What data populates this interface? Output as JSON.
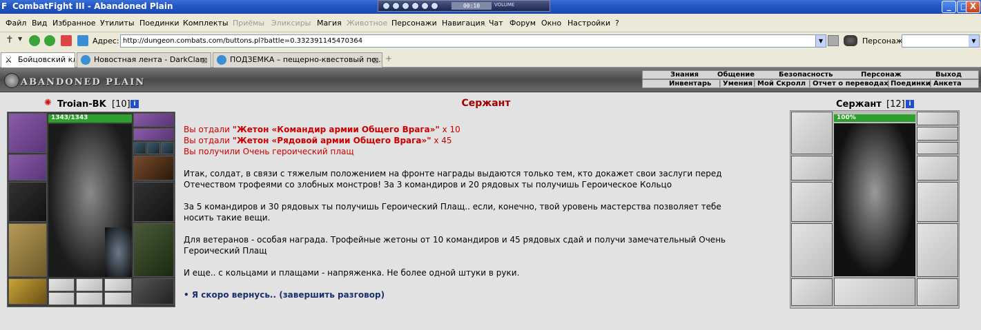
{
  "window": {
    "title": "CombatFight III - Abandoned Plain",
    "app_icon": "F",
    "minimize": "_",
    "maximize": "□",
    "close": "X"
  },
  "player": {
    "time": "00:10",
    "volume_label": "VOLUME"
  },
  "menu": [
    {
      "label": "Файл",
      "enabled": true
    },
    {
      "label": "Вид",
      "enabled": true
    },
    {
      "label": "Избранное",
      "enabled": true
    },
    {
      "label": "Утилиты",
      "enabled": true
    },
    {
      "label": "Поединки",
      "enabled": true
    },
    {
      "label": "Комплекты",
      "enabled": true
    },
    {
      "label": "Приёмы",
      "enabled": false
    },
    {
      "label": "Эликсиры",
      "enabled": false
    },
    {
      "label": "Магия",
      "enabled": true
    },
    {
      "label": "Животное",
      "enabled": false
    },
    {
      "label": "Персонажи",
      "enabled": true
    },
    {
      "label": "Навигация",
      "enabled": true
    },
    {
      "label": "Чат",
      "enabled": true
    },
    {
      "label": "Форум",
      "enabled": true
    },
    {
      "label": "Окно",
      "enabled": true
    },
    {
      "label": "Настройки",
      "enabled": true
    },
    {
      "label": "?",
      "enabled": true
    }
  ],
  "address": {
    "label": "Адрес:",
    "url": "http://dungeon.combats.com/buttons.pl?battle=0.332391145470364",
    "character_label": "Персонаж:"
  },
  "tabs": [
    {
      "label": "Бойцовский клуб",
      "active": true
    },
    {
      "label": "Новостная лента - DarkClan",
      "active": false
    },
    {
      "label": "ПОДЗЕМКА – пещерно-квестовый по...",
      "active": false
    }
  ],
  "game": {
    "logo": "ABANDONED PLAIN",
    "top_menu": [
      "Знания",
      "Общение",
      "Безопасность",
      "Персонаж",
      "Выход"
    ],
    "sub_menu": [
      "Инвентарь",
      "Умения",
      "Мой Скролл",
      "Отчет о переводах",
      "Поединки",
      "Анкета"
    ]
  },
  "player_char": {
    "name": "Troian-BK",
    "level": "[10]",
    "hp": "1343/1343",
    "hp_fraction": 1.0
  },
  "npc": {
    "name": "Сержант",
    "level": "[12]",
    "hp": "100%",
    "hp_fraction": 1.0
  },
  "dialog": {
    "title": "Сержант",
    "given1_prefix": "Вы отдали ",
    "given1_item": "\"Жетон «Командир армии Общего Врага»\"",
    "given1_count": " x 10",
    "given2_prefix": "Вы отдали ",
    "given2_item": "\"Жетон «Рядовой армии Общего Врага»\"",
    "given2_count": " x 45",
    "received": "Вы получили Очень героический плащ",
    "p1_l1": "Итак, солдат, в связи с тяжелым положением на фронте награды выдаются только тем, кто докажет свои заслуги перед",
    "p1_l2": "Отечеством трофеями со злобных монстров! За 3 командиров и 20 рядовых ты получишь Героическое Кольцо",
    "p2_l1": "За 5 командиров и 30 рядовых ты получишь Героический Плащ.. если, конечно, твой уровень мастерства позволяет тебе",
    "p2_l2": "носить такие вещи.",
    "p3_l1": "Для ветеранов - особая награда. Трофейные жетоны от 10 командиров и 45 рядовых сдай и получи замечательный Очень",
    "p3_l2": "Героический Плащ",
    "p4": "И еще.. с кольцами и плащами - напряженка. Не более одной штуки в руки.",
    "bullet": "•",
    "exit_link": "Я скоро вернусь.. (завершить разговор)"
  },
  "colors": {
    "red": "#cc0000",
    "link": "#1a2f6e",
    "hp_green": "#2e9e2e",
    "info_blue": "#1f4fd0"
  }
}
